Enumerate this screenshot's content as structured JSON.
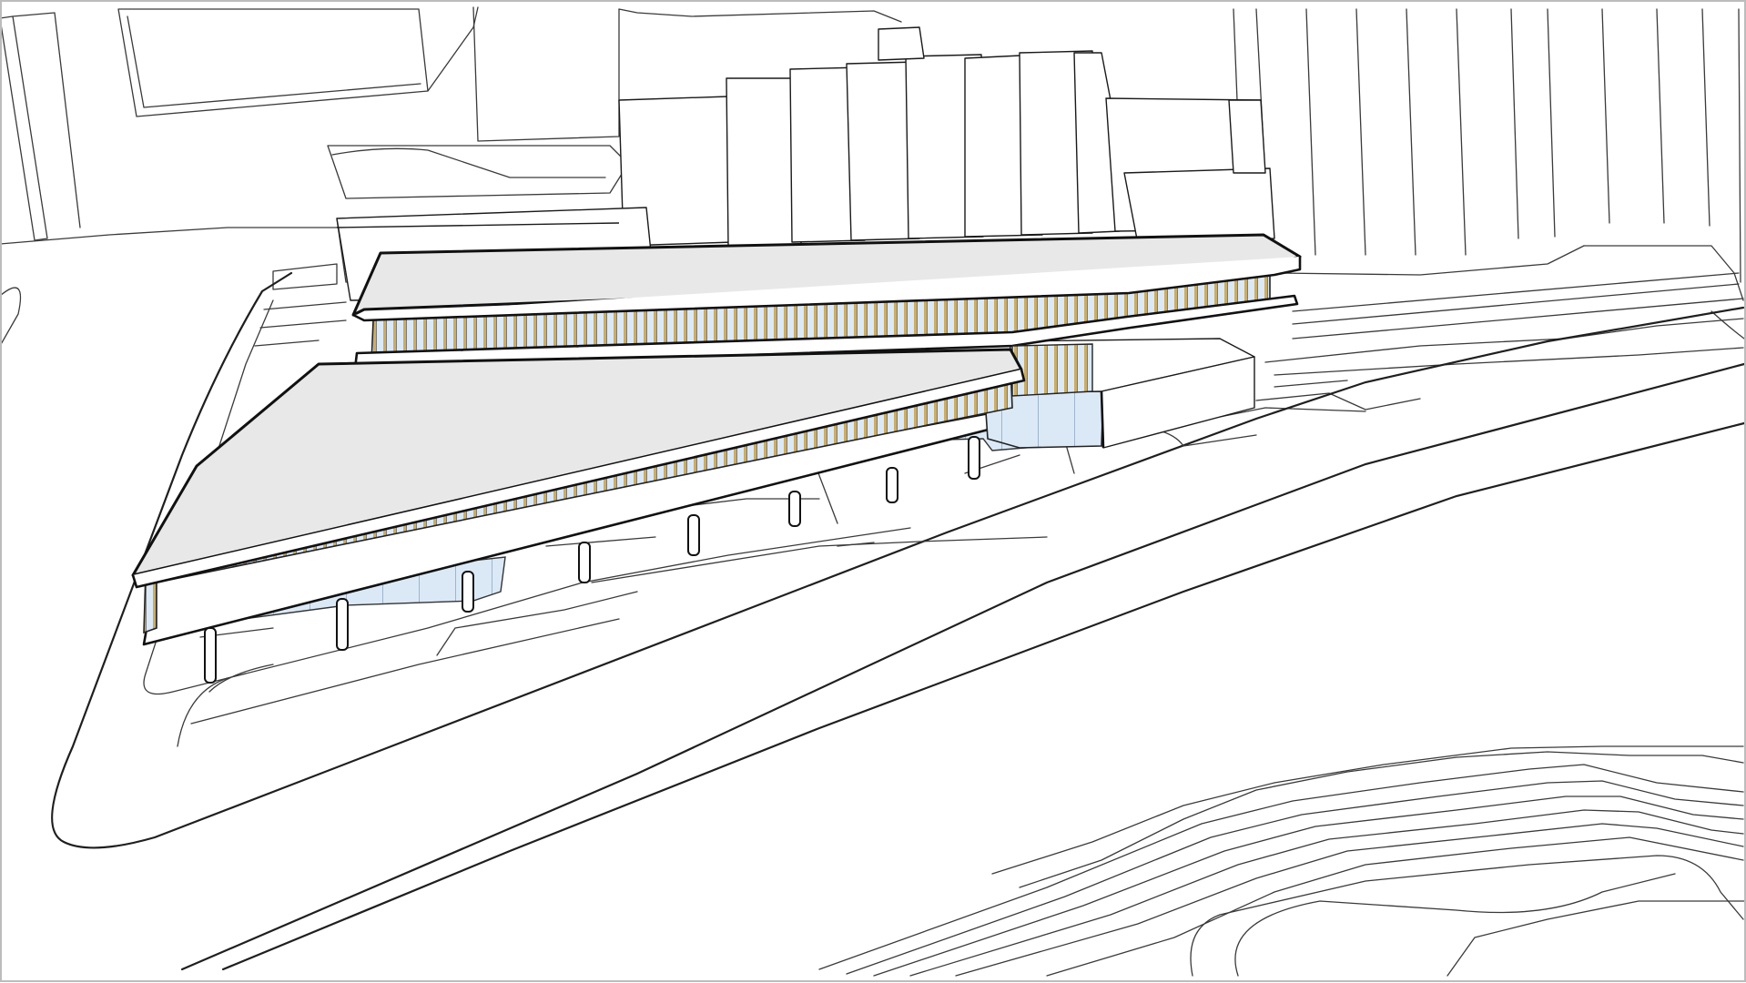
{
  "viewport": {
    "background": "#ffffff",
    "frame_color": "#bcbcbc"
  },
  "model": {
    "roof_color": "#e8e8e8",
    "glass_color": "#dbe9f7",
    "fin_color": "#c9a24a",
    "edge_color": "#111111",
    "context_fill": "#ffffff"
  }
}
